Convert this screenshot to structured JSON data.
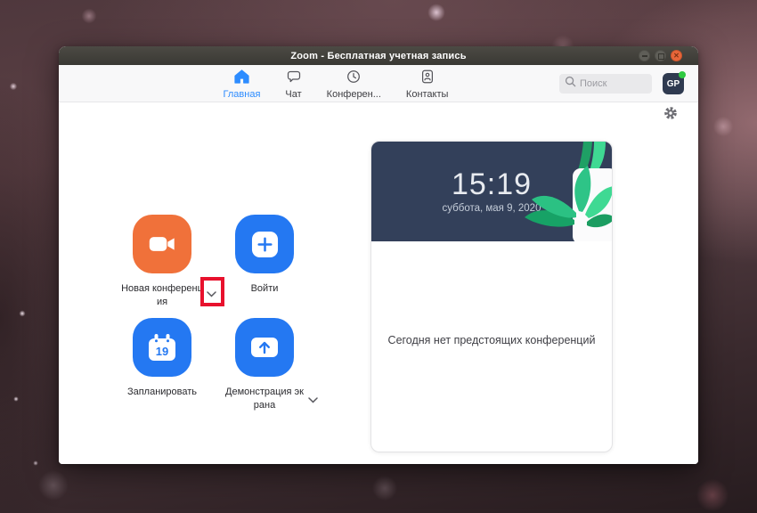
{
  "window": {
    "title": "Zoom - Бесплатная учетная запись"
  },
  "header": {
    "tabs": [
      {
        "label": "Главная",
        "icon": "home-icon",
        "active": true
      },
      {
        "label": "Чат",
        "icon": "chat-bubble-icon",
        "active": false
      },
      {
        "label": "Конферен...",
        "icon": "clock-icon",
        "active": false
      },
      {
        "label": "Контакты",
        "icon": "contacts-icon",
        "active": false
      }
    ],
    "search": {
      "placeholder": "Поиск",
      "icon": "search-icon"
    },
    "avatar": {
      "initials": "GP",
      "status": "online"
    }
  },
  "actions": [
    {
      "label": "Новая конференц\nия",
      "icon": "video-camera-icon",
      "color": "#f0713a",
      "has_dropdown": true,
      "dropdown_highlighted": true
    },
    {
      "label": "Войти",
      "icon": "plus-icon",
      "color": "#2478f2",
      "has_dropdown": false
    },
    {
      "label": "Запланировать",
      "icon": "calendar-icon",
      "calendar_day": "19",
      "color": "#2478f2",
      "has_dropdown": false
    },
    {
      "label": "Демонстрация эк\nрана",
      "icon": "screen-share-icon",
      "color": "#2478f2",
      "has_dropdown": true
    }
  ],
  "panel": {
    "time": "15:19",
    "date": "суббота, мая 9, 2020",
    "empty_message": "Сегодня нет предстоящих конференций"
  },
  "colors": {
    "accent_blue": "#2d8cff",
    "action_blue": "#2478f2",
    "action_orange": "#f0713a",
    "card_header_navy": "#33405a",
    "status_green": "#2fc941",
    "annotation_red": "#e8112d",
    "titlebar": "#3f3e39"
  },
  "icons": {
    "window_controls": [
      "minimize-icon",
      "maximize-icon",
      "close-icon"
    ],
    "other": [
      "gear-icon",
      "chevron-down-icon",
      "plant-illustration"
    ]
  }
}
